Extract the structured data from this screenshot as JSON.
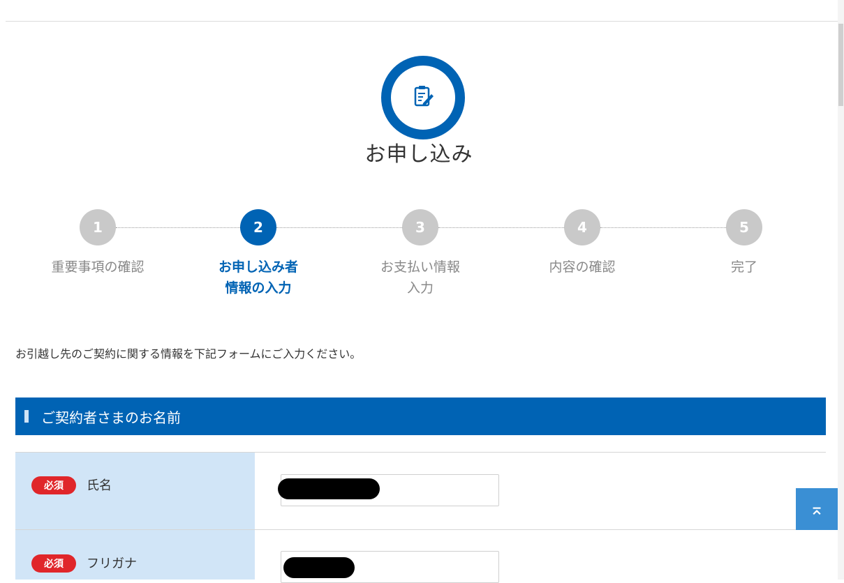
{
  "hero": {
    "icon": "clipboard-pen-icon",
    "title": "お申し込み"
  },
  "steps": [
    {
      "number": "1",
      "label_line1": "重要事項の確認",
      "label_line2": "",
      "active": false
    },
    {
      "number": "2",
      "label_line1": "お申し込み者",
      "label_line2": "情報の入力",
      "active": true
    },
    {
      "number": "3",
      "label_line1": "お支払い情報",
      "label_line2": "入力",
      "active": false
    },
    {
      "number": "4",
      "label_line1": "内容の確認",
      "label_line2": "",
      "active": false
    },
    {
      "number": "5",
      "label_line1": "完了",
      "label_line2": "",
      "active": false
    }
  ],
  "intro_text": "お引越し先のご契約に関する情報を下記フォームにご入力ください。",
  "section": {
    "title": "ご契約者さまのお名前"
  },
  "form": {
    "rows": [
      {
        "required_label": "必須",
        "label": "氏名",
        "value_redacted": true
      },
      {
        "required_label": "必須",
        "label": "フリガナ",
        "value_redacted": true
      }
    ]
  },
  "scroll_top": {
    "icon": "arrow-up-to-top-icon",
    "glyph": "⌅"
  },
  "colors": {
    "primary": "#0063b4",
    "inactive_step": "#c9c9c9",
    "required_badge": "#e0262a",
    "label_cell": "#d1e5f7",
    "scroll_button": "#3a8fd4"
  }
}
